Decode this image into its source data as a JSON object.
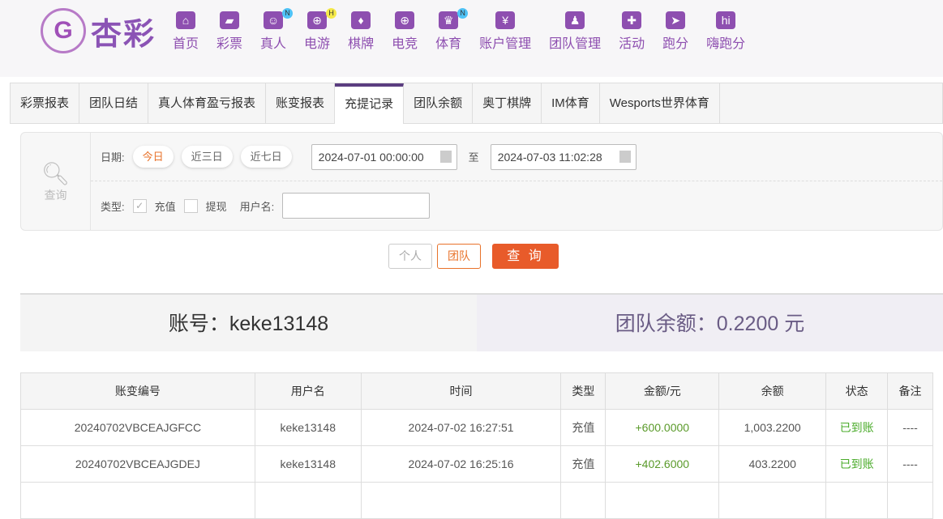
{
  "brand": {
    "name": "杏彩"
  },
  "nav": [
    {
      "label": "首页",
      "icon": "home-icon"
    },
    {
      "label": "彩票",
      "icon": "ticket-icon"
    },
    {
      "label": "真人",
      "icon": "live-dealer-icon",
      "badge": "N"
    },
    {
      "label": "电游",
      "icon": "gamepad-icon",
      "badge": "H"
    },
    {
      "label": "棋牌",
      "icon": "cards-icon"
    },
    {
      "label": "电竞",
      "icon": "gamepad-icon"
    },
    {
      "label": "体育",
      "icon": "trophy-icon",
      "badge": "N"
    },
    {
      "label": "账户管理",
      "icon": "yen-icon"
    },
    {
      "label": "团队管理",
      "icon": "team-icon"
    },
    {
      "label": "活动",
      "icon": "gift-icon"
    },
    {
      "label": "跑分",
      "icon": "car-icon"
    },
    {
      "label": "嗨跑分",
      "icon": "hi-icon"
    }
  ],
  "tabs": [
    "彩票报表",
    "团队日结",
    "真人体育盈亏报表",
    "账变报表",
    "充提记录",
    "团队余额",
    "奥丁棋牌",
    "IM体育",
    "Wesports世界体育"
  ],
  "filter": {
    "query_label": "查询",
    "date_label": "日期:",
    "quick": [
      "今日",
      "近三日",
      "近七日"
    ],
    "start": "2024-07-01 00:00:00",
    "to": "至",
    "end": "2024-07-03 11:02:28",
    "type_label": "类型:",
    "deposit": "充值",
    "withdraw": "提现",
    "username_label": "用户名:",
    "username_value": ""
  },
  "buttons": {
    "personal": "个人",
    "team": "团队",
    "query": "查 询"
  },
  "summary": {
    "account": "账号：keke13148",
    "balance": "团队余额：0.2200 元"
  },
  "table": {
    "headers": [
      "账变编号",
      "用户名",
      "时间",
      "类型",
      "金额/元",
      "余额",
      "状态",
      "备注"
    ],
    "rows": [
      [
        "20240702VBCEAJGFCC",
        "keke13148",
        "2024-07-02 16:27:51",
        "充值",
        "+600.0000",
        "1,003.2200",
        "已到账",
        "----"
      ],
      [
        "20240702VBCEAJGDEJ",
        "keke13148",
        "2024-07-02 16:25:16",
        "充值",
        "+402.6000",
        "403.2200",
        "已到账",
        "----"
      ]
    ]
  }
}
